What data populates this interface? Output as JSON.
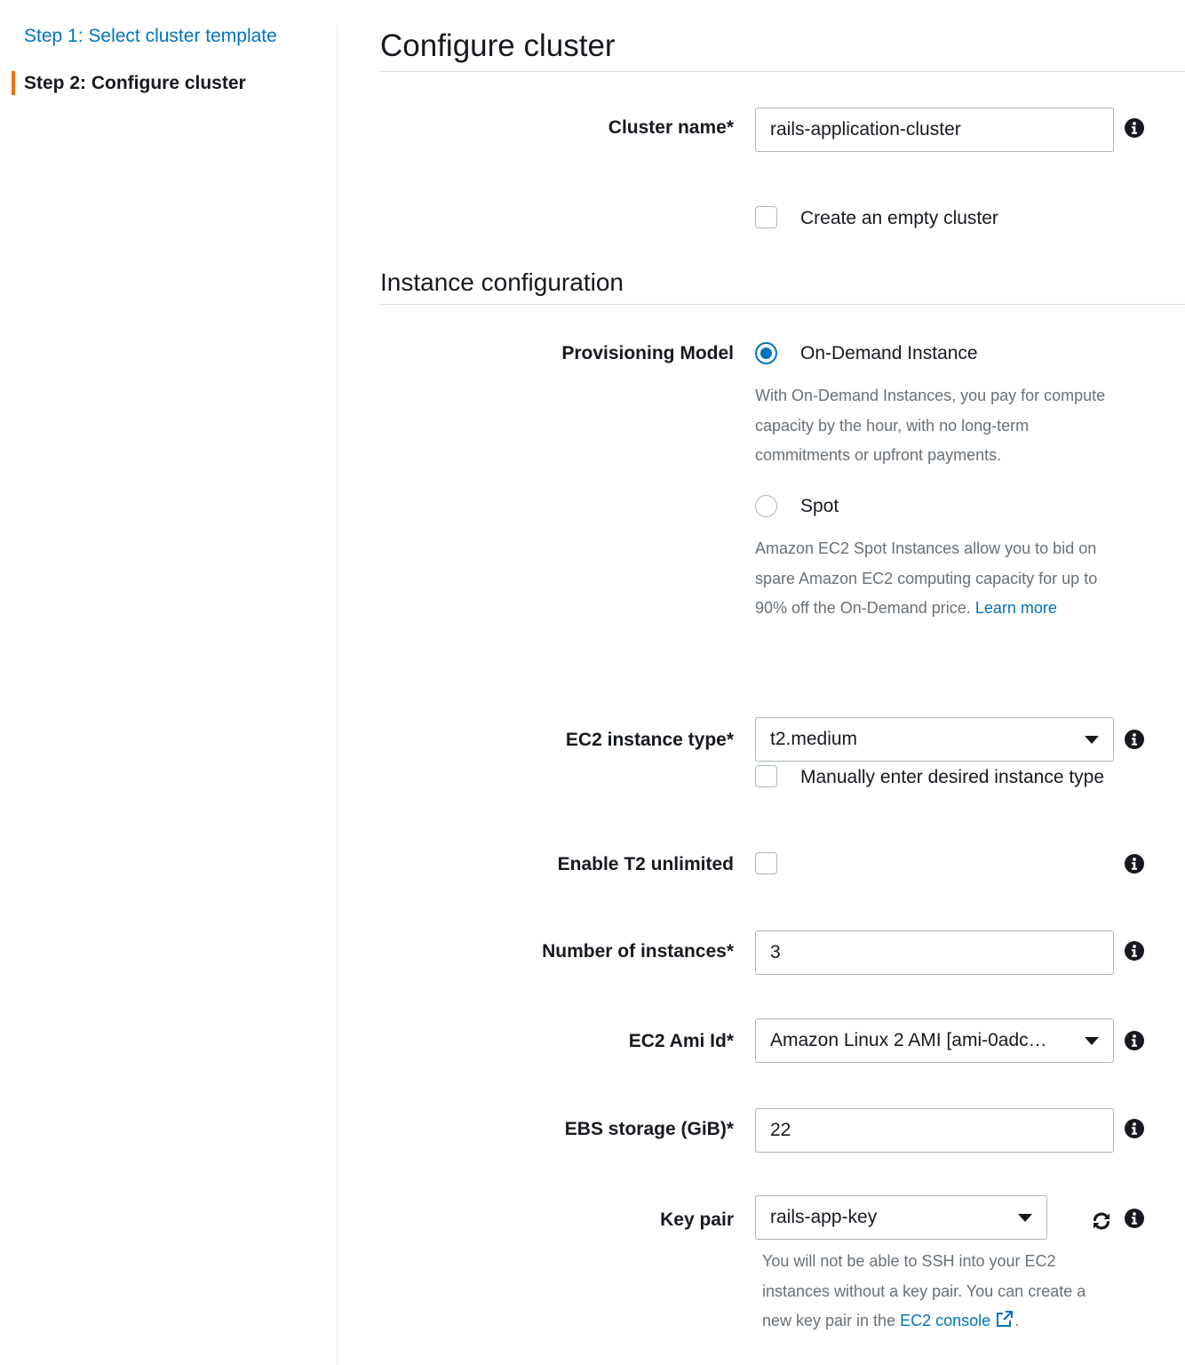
{
  "nav": {
    "steps": [
      {
        "label": "Step 1: Select cluster template",
        "state": "link"
      },
      {
        "label": "Step 2: Configure cluster",
        "state": "current"
      }
    ]
  },
  "page": {
    "title": "Configure cluster",
    "section_title": "Instance configuration"
  },
  "cluster_name": {
    "label": "Cluster name*",
    "value": "rails-application-cluster"
  },
  "empty_cluster": {
    "label": "Create an empty cluster",
    "checked": false
  },
  "provisioning": {
    "label": "Provisioning Model",
    "on_demand": {
      "label": "On-Demand Instance",
      "selected": true,
      "description": "With On-Demand Instances, you pay for compute capacity by the hour, with no long-term commitments or upfront payments."
    },
    "spot": {
      "label": "Spot",
      "selected": false,
      "description": "Amazon EC2 Spot Instances allow you to bid on spare Amazon EC2 computing capacity for up to 90% off the On-Demand price.",
      "learn_more": "Learn more"
    }
  },
  "instance_type": {
    "label": "EC2 instance type*",
    "value": "t2.medium",
    "manual_label": "Manually enter desired instance type",
    "manual_checked": false
  },
  "t2_unlimited": {
    "label": "Enable T2 unlimited",
    "checked": false
  },
  "num_instances": {
    "label": "Number of instances*",
    "value": "3"
  },
  "ami": {
    "label": "EC2 Ami Id*",
    "value": "Amazon Linux 2 AMI [ami-0adc…"
  },
  "ebs": {
    "label": "EBS storage (GiB)*",
    "value": "22"
  },
  "key_pair": {
    "label": "Key pair",
    "value": "rails-app-key",
    "help_prefix": "You will not be able to SSH into your EC2 instances without a key pair. You can create a new key pair in the",
    "console_link": "EC2 console",
    "help_suffix": "."
  },
  "colors": {
    "link": "#0073bb",
    "accent": "#ec7211",
    "text": "#16191f",
    "muted": "#687078",
    "border": "#aab7b8"
  },
  "icons": {
    "info": "info-circle-icon",
    "refresh": "refresh-icon",
    "external": "external-link-icon",
    "caret": "caret-down-icon"
  }
}
